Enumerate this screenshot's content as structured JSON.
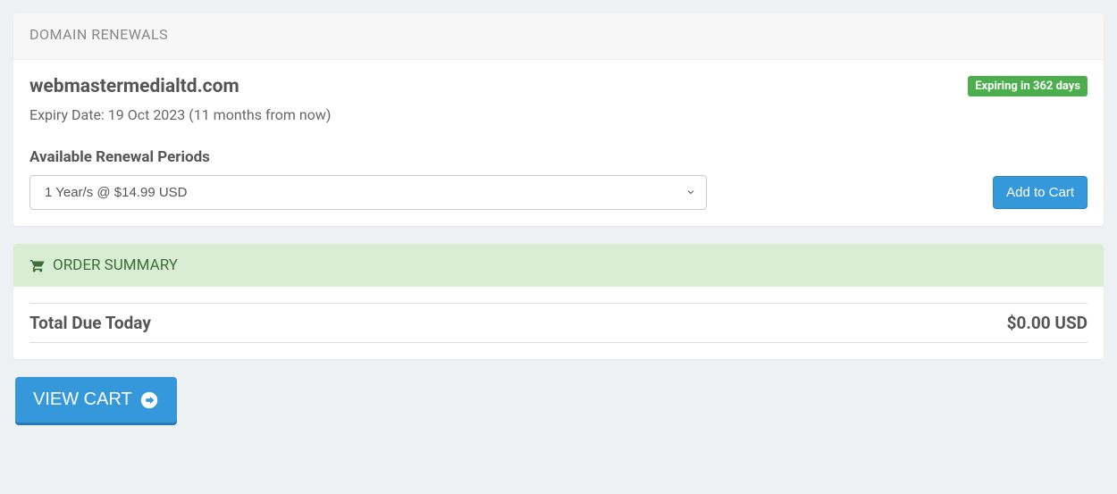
{
  "renewals": {
    "header": "DOMAIN RENEWALS",
    "domain": "webmastermedialtd.com",
    "expiry_text": "Expiry Date: 19 Oct 2023 (11 months from now)",
    "badge": "Expiring in 362 days",
    "period_label": "Available Renewal Periods",
    "period_selected": "1 Year/s @ $14.99 USD",
    "add_to_cart": "Add to Cart"
  },
  "summary": {
    "header": "ORDER SUMMARY",
    "total_label": "Total Due Today",
    "total_value": "$0.00 USD"
  },
  "actions": {
    "view_cart": "VIEW CART"
  }
}
